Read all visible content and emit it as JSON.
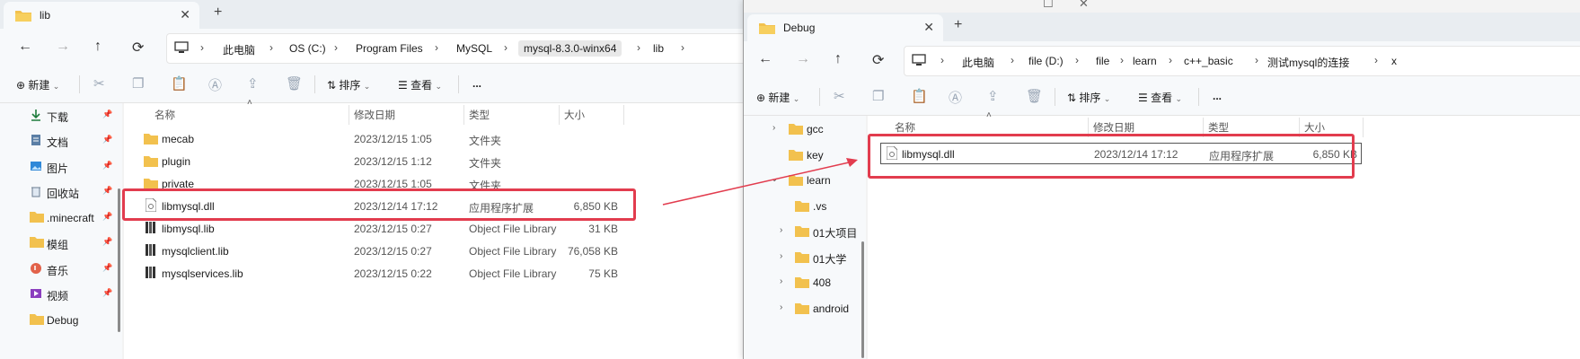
{
  "left_window": {
    "tab_title": "lib",
    "breadcrumbs": [
      "此电脑",
      "OS (C:)",
      "Program Files",
      "MySQL",
      "mysql-8.3.0-winx64",
      "lib"
    ],
    "toolbar": {
      "new_label": "新建",
      "sort_label": "排序",
      "view_label": "查看",
      "more_label": "..."
    },
    "nav_items": [
      {
        "label": "下载",
        "icon": "download-icon"
      },
      {
        "label": "文档",
        "icon": "document-icon"
      },
      {
        "label": "图片",
        "icon": "picture-icon"
      },
      {
        "label": "回收站",
        "icon": "recycle-bin-icon"
      },
      {
        "label": ".minecraft",
        "icon": "folder-icon"
      },
      {
        "label": "模组",
        "icon": "folder-icon"
      },
      {
        "label": "音乐",
        "icon": "music-icon"
      },
      {
        "label": "视频",
        "icon": "video-icon"
      },
      {
        "label": "Debug",
        "icon": "folder-icon"
      }
    ],
    "columns": {
      "name": "名称",
      "modified": "修改日期",
      "type": "类型",
      "size": "大小"
    },
    "files": [
      {
        "name": "mecab",
        "modified": "2023/12/15 1:05",
        "type": "文件夹",
        "size": "",
        "icon": "folder-icon"
      },
      {
        "name": "plugin",
        "modified": "2023/12/15 1:12",
        "type": "文件夹",
        "size": "",
        "icon": "folder-icon"
      },
      {
        "name": "private",
        "modified": "2023/12/15 1:05",
        "type": "文件夹",
        "size": "",
        "icon": "folder-icon"
      },
      {
        "name": "libmysql.dll",
        "modified": "2023/12/14 17:12",
        "type": "应用程序扩展",
        "size": "6,850 KB",
        "icon": "dll-file-icon"
      },
      {
        "name": "libmysql.lib",
        "modified": "2023/12/15 0:27",
        "type": "Object File Library",
        "size": "31 KB",
        "icon": "lib-file-icon"
      },
      {
        "name": "mysqlclient.lib",
        "modified": "2023/12/15 0:27",
        "type": "Object File Library",
        "size": "76,058 KB",
        "icon": "lib-file-icon"
      },
      {
        "name": "mysqlservices.lib",
        "modified": "2023/12/15 0:22",
        "type": "Object File Library",
        "size": "75 KB",
        "icon": "lib-file-icon"
      }
    ]
  },
  "right_window": {
    "tab_title": "Debug",
    "breadcrumbs": [
      "此电脑",
      "file (D:)",
      "file",
      "learn",
      "c++_basic",
      "测试mysql的连接",
      "x"
    ],
    "toolbar": {
      "new_label": "新建",
      "sort_label": "排序",
      "view_label": "查看",
      "more_label": "..."
    },
    "tree_items": [
      {
        "label": "gcc",
        "expandable": true,
        "indent": 0
      },
      {
        "label": "key",
        "expandable": false,
        "indent": 0
      },
      {
        "label": "learn",
        "expandable": true,
        "expanded": true,
        "indent": 0
      },
      {
        "label": ".vs",
        "expandable": false,
        "indent": 1
      },
      {
        "label": "01大项目",
        "expandable": true,
        "indent": 1
      },
      {
        "label": "01大学",
        "expandable": true,
        "indent": 1
      },
      {
        "label": "408",
        "expandable": true,
        "indent": 1
      },
      {
        "label": "android",
        "expandable": true,
        "indent": 1
      }
    ],
    "columns": {
      "name": "名称",
      "modified": "修改日期",
      "type": "类型",
      "size": "大小"
    },
    "files": [
      {
        "name": "libmysql.dll",
        "modified": "2023/12/14 17:12",
        "type": "应用程序扩展",
        "size": "6,850 KB",
        "icon": "dll-file-icon"
      }
    ]
  },
  "colors": {
    "highlight": "#e23c4e",
    "folder": "#f2c14e",
    "accent": "#0f6cbd"
  }
}
